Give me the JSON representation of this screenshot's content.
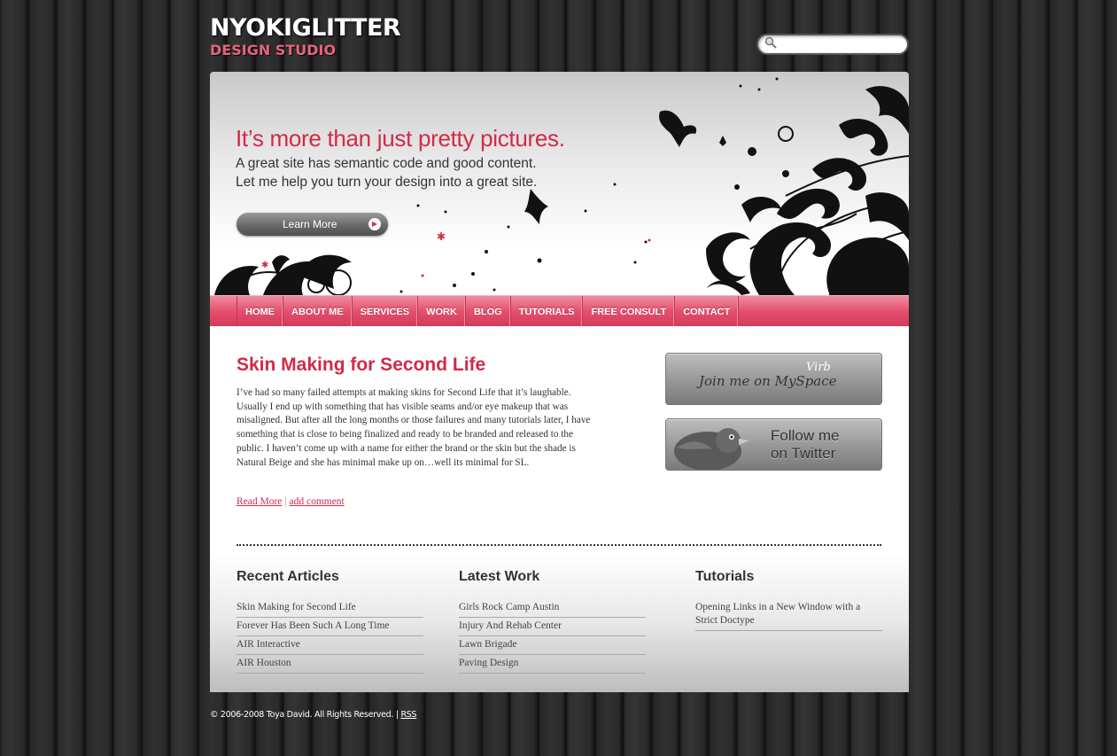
{
  "brand": {
    "name": "NYOKIGLITTER",
    "tagline": "DESIGN STUDIO"
  },
  "search": {
    "placeholder": "",
    "value": ""
  },
  "hero": {
    "title": "It’s more than just pretty pictures.",
    "line1": "A great site has semantic code and good content.",
    "line2": "Let me help you turn your design into a great site.",
    "button_label": "Learn More"
  },
  "nav": {
    "items": [
      "HOME",
      "ABOUT ME",
      "SERVICES",
      "WORK",
      "BLOG",
      "TUTORIALS",
      "FREE CONSULT",
      "CONTACT"
    ]
  },
  "post": {
    "title": "Skin Making for Second Life",
    "body": "I’ve had so many failed attempts at making skins for Second Life that it’s laughable. Usually I end up with something that has visible seams and/or eye makeup that was misaligned. But after all the long months or those failures and many tutorials later, I have something that is close to being finalized and ready to be branded and released to the public. I haven’t come up with a name for either the brand or the skin but the shade is Natural Beige and she has minimal make up on…well its minimal for SL.",
    "read_more": "Read More",
    "separator": "|",
    "add_comment": "add comment"
  },
  "sidebar": {
    "myspace_text": "Join me on MySpace",
    "myspace_overlay": "Virb",
    "twitter_line1": "Follow me",
    "twitter_line2": "on Twitter"
  },
  "columns": [
    {
      "title": "Recent Articles",
      "items": [
        "Skin Making for Second Life",
        "Forever Has Been Such A Long Time",
        "AIR Interactive",
        "AIR Houston"
      ]
    },
    {
      "title": "Latest Work",
      "items": [
        "Girls Rock Camp Austin",
        "Injury And Rehab Center",
        "Lawn Brigade",
        "Paving Design"
      ]
    },
    {
      "title": "Tutorials",
      "items": [
        "Opening Links in a New Window with a Strict Doctype"
      ]
    }
  ],
  "footer": {
    "copyright": "© 2006-2008 Toya David. All Rights Reserved.",
    "separator": "|",
    "rss": "RSS"
  },
  "colors": {
    "accent": "#d12a4a",
    "nav_pink": "#e4506e",
    "brand_pink": "#e4657f"
  },
  "icons": {
    "search": "search-icon",
    "arrow": "play-arrow-icon",
    "bird": "twitter-bird-icon"
  }
}
